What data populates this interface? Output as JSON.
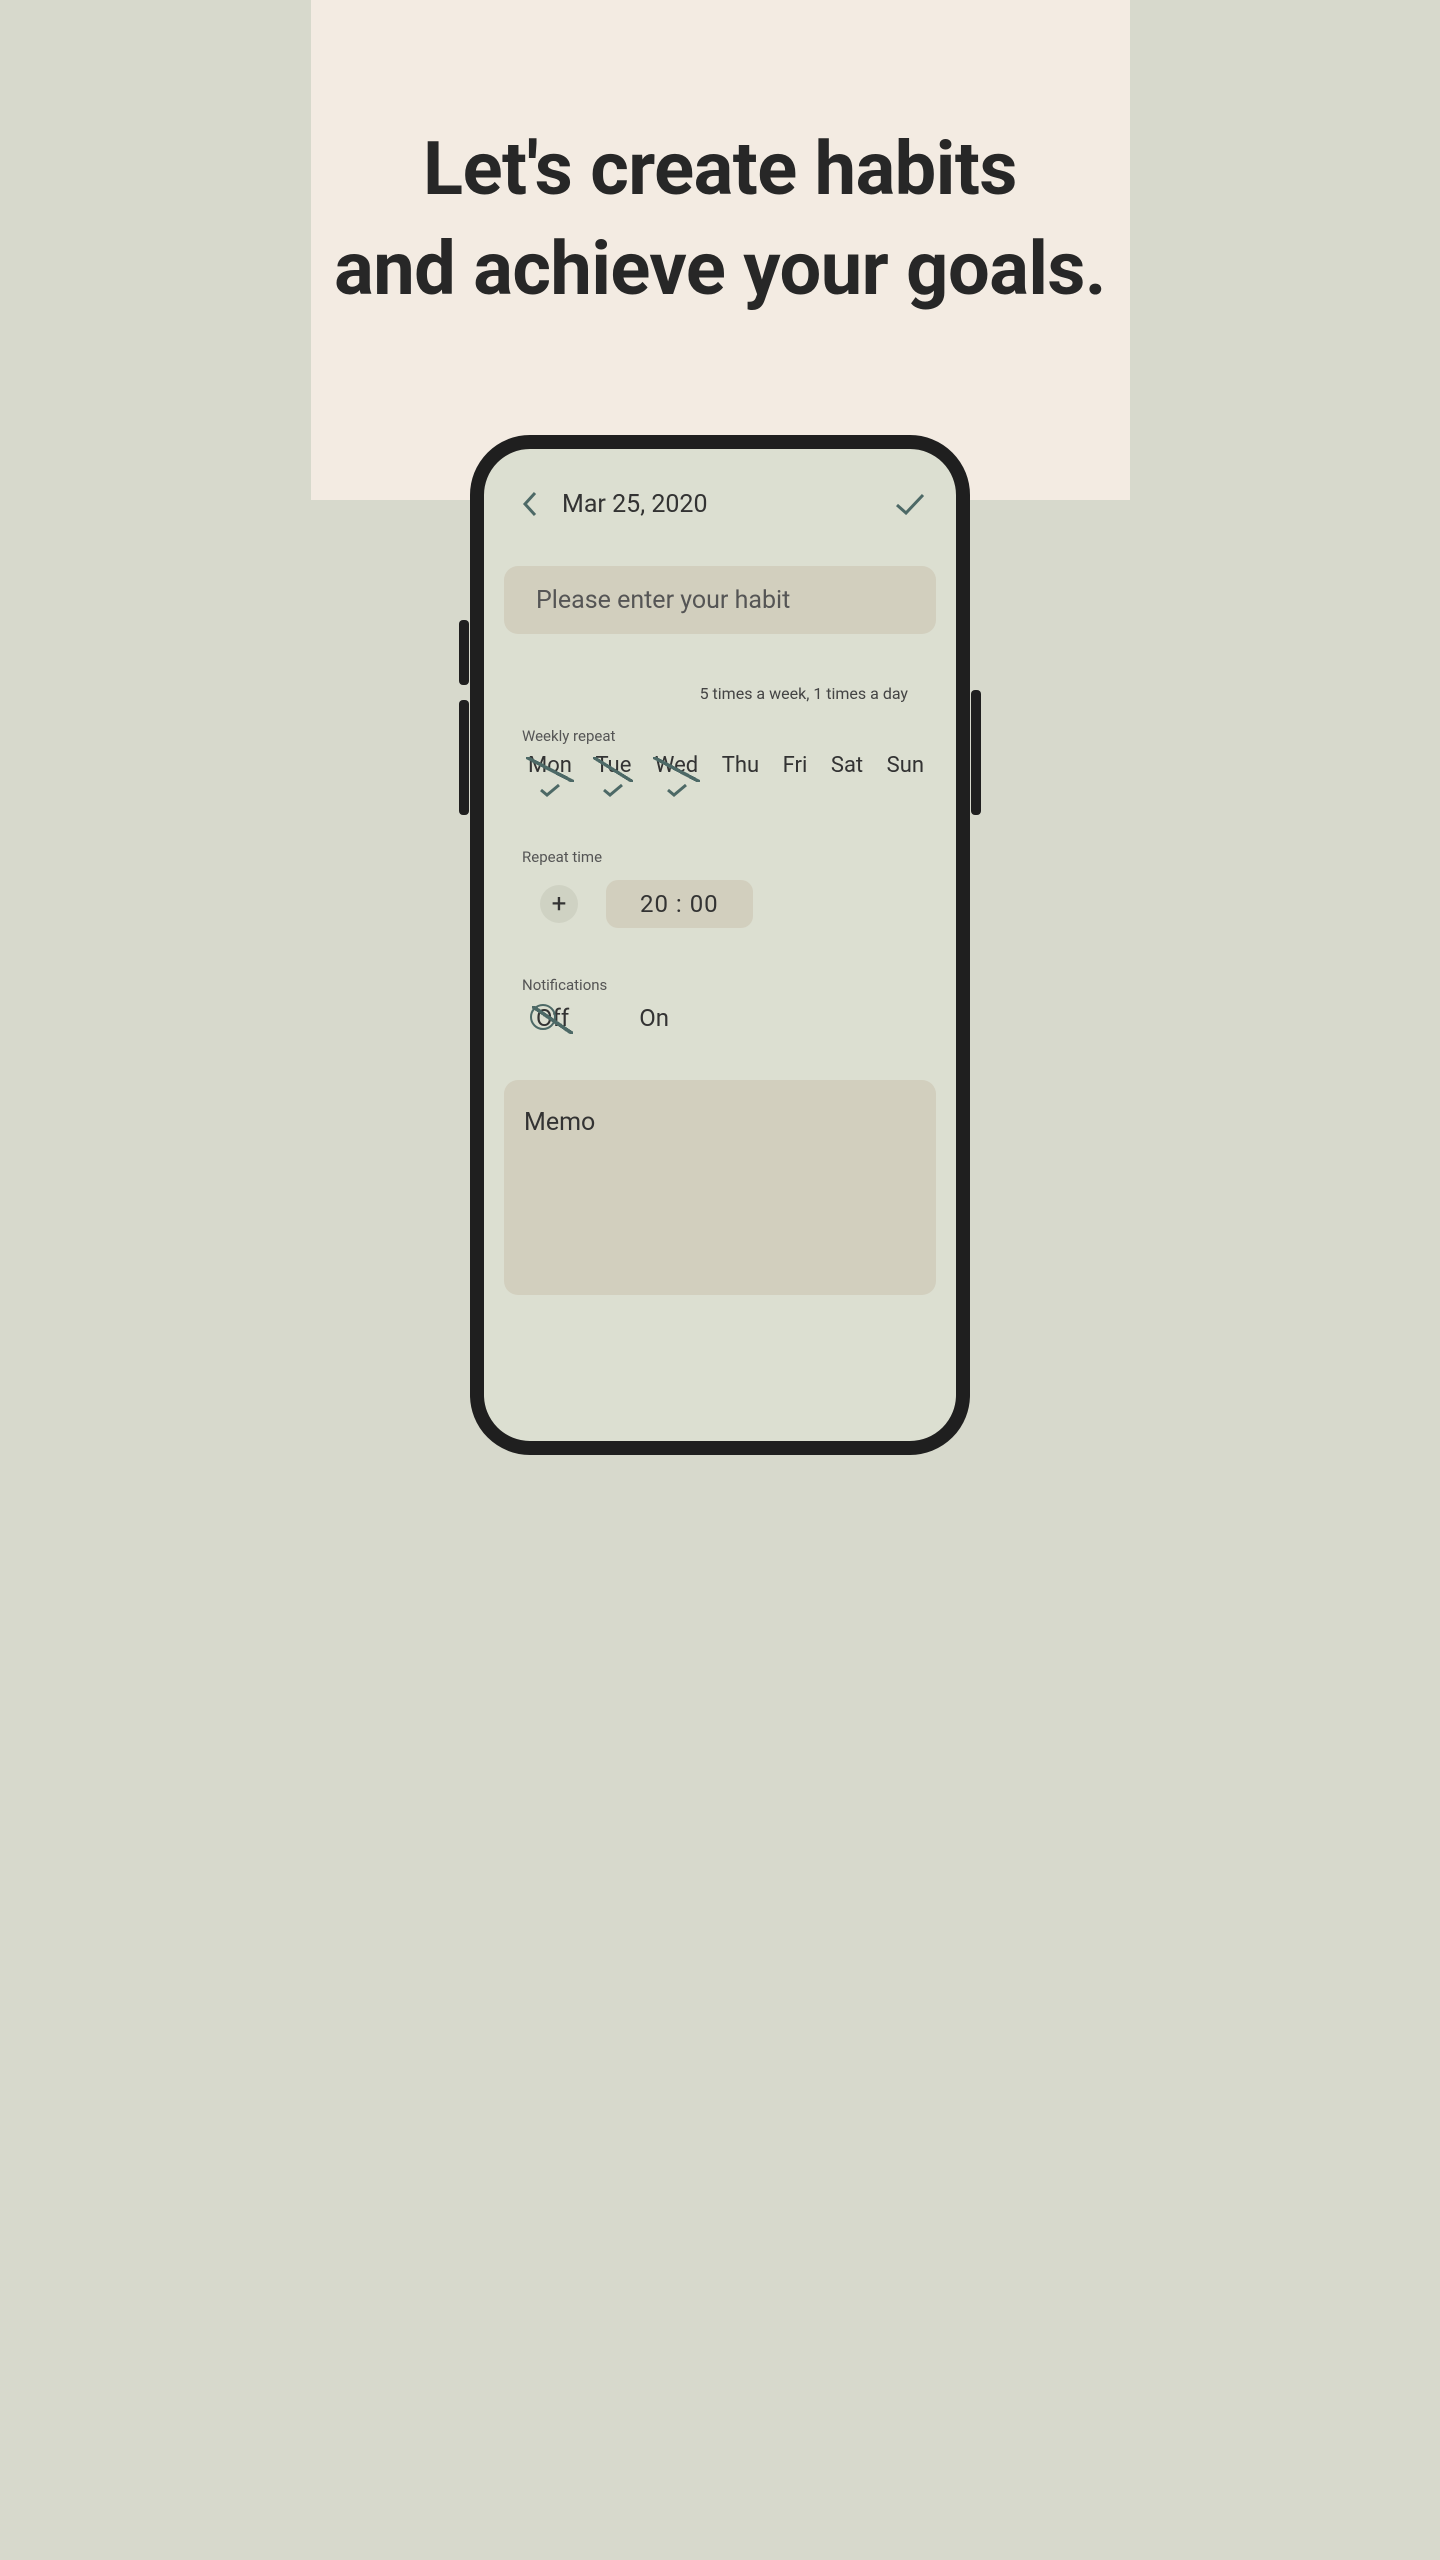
{
  "headline": "Let's create habits\nand achieve your goals.",
  "topbar": {
    "date": "Mar 25, 2020"
  },
  "habit_input": {
    "placeholder": "Please enter your habit"
  },
  "summary": "5 times a week, 1 times a day",
  "weekly_repeat": {
    "label": "Weekly repeat",
    "days": [
      {
        "label": "Mon",
        "selected": true
      },
      {
        "label": "Tue",
        "selected": true
      },
      {
        "label": "Wed",
        "selected": true
      },
      {
        "label": "Thu",
        "selected": false
      },
      {
        "label": "Fri",
        "selected": false
      },
      {
        "label": "Sat",
        "selected": false
      },
      {
        "label": "Sun",
        "selected": false
      }
    ]
  },
  "repeat_time": {
    "label": "Repeat time",
    "time": "20 : 00"
  },
  "notifications": {
    "label": "Notifications",
    "off_label": "Off",
    "on_label": "On"
  },
  "memo": {
    "placeholder": "Memo"
  }
}
